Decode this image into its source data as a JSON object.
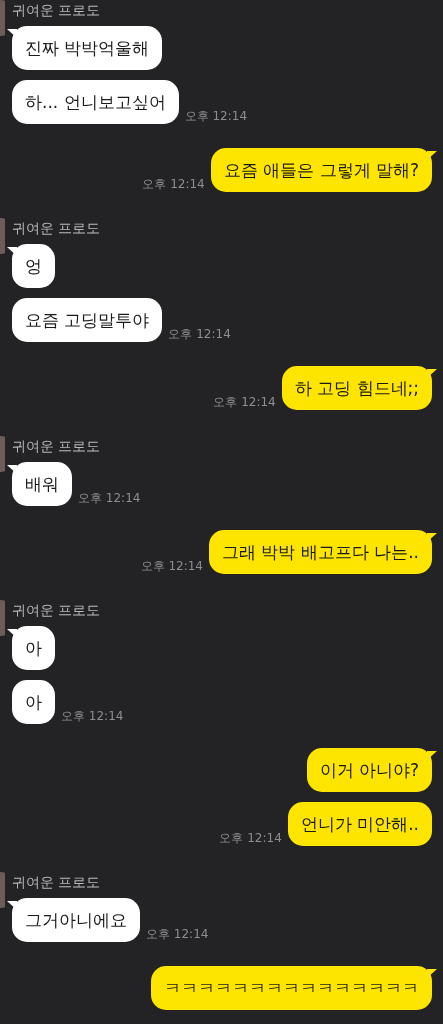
{
  "groups": [
    {
      "kind": "received",
      "sender": "귀여운 프로도",
      "messages": [
        {
          "text": "진짜 박박억울해"
        },
        {
          "text": "하... 언니보고싶어",
          "time": "오후 12:14"
        }
      ]
    },
    {
      "kind": "sent",
      "messages": [
        {
          "text": "요즘 애들은 그렇게 말해?",
          "time": "오후 12:14"
        }
      ]
    },
    {
      "kind": "received",
      "sender": "귀여운 프로도",
      "messages": [
        {
          "text": "엉"
        },
        {
          "text": "요즘 고딩말투야",
          "time": "오후 12:14"
        }
      ]
    },
    {
      "kind": "sent",
      "messages": [
        {
          "text": "하 고딩 힘드네;;",
          "time": "오후 12:14"
        }
      ]
    },
    {
      "kind": "received",
      "sender": "귀여운 프로도",
      "messages": [
        {
          "text": "배워",
          "time": "오후 12:14"
        }
      ]
    },
    {
      "kind": "sent",
      "messages": [
        {
          "text": "그래 박박 배고프다 나는..",
          "time": "오후 12:14"
        }
      ]
    },
    {
      "kind": "received",
      "sender": "귀여운 프로도",
      "messages": [
        {
          "text": "아"
        },
        {
          "text": "아",
          "time": "오후 12:14"
        }
      ]
    },
    {
      "kind": "sent",
      "messages": [
        {
          "text": "이거 아니야?"
        },
        {
          "text": "언니가 미안해..",
          "time": "오후 12:14"
        }
      ]
    },
    {
      "kind": "received",
      "sender": "귀여운 프로도",
      "messages": [
        {
          "text": "그거아니에요",
          "time": "오후 12:14"
        }
      ]
    },
    {
      "kind": "sent",
      "messages": [
        {
          "text": "ㅋㅋㅋㅋㅋㅋㅋㅋㅋㅋㅋㅋㅋㅋㅋ"
        }
      ]
    }
  ]
}
